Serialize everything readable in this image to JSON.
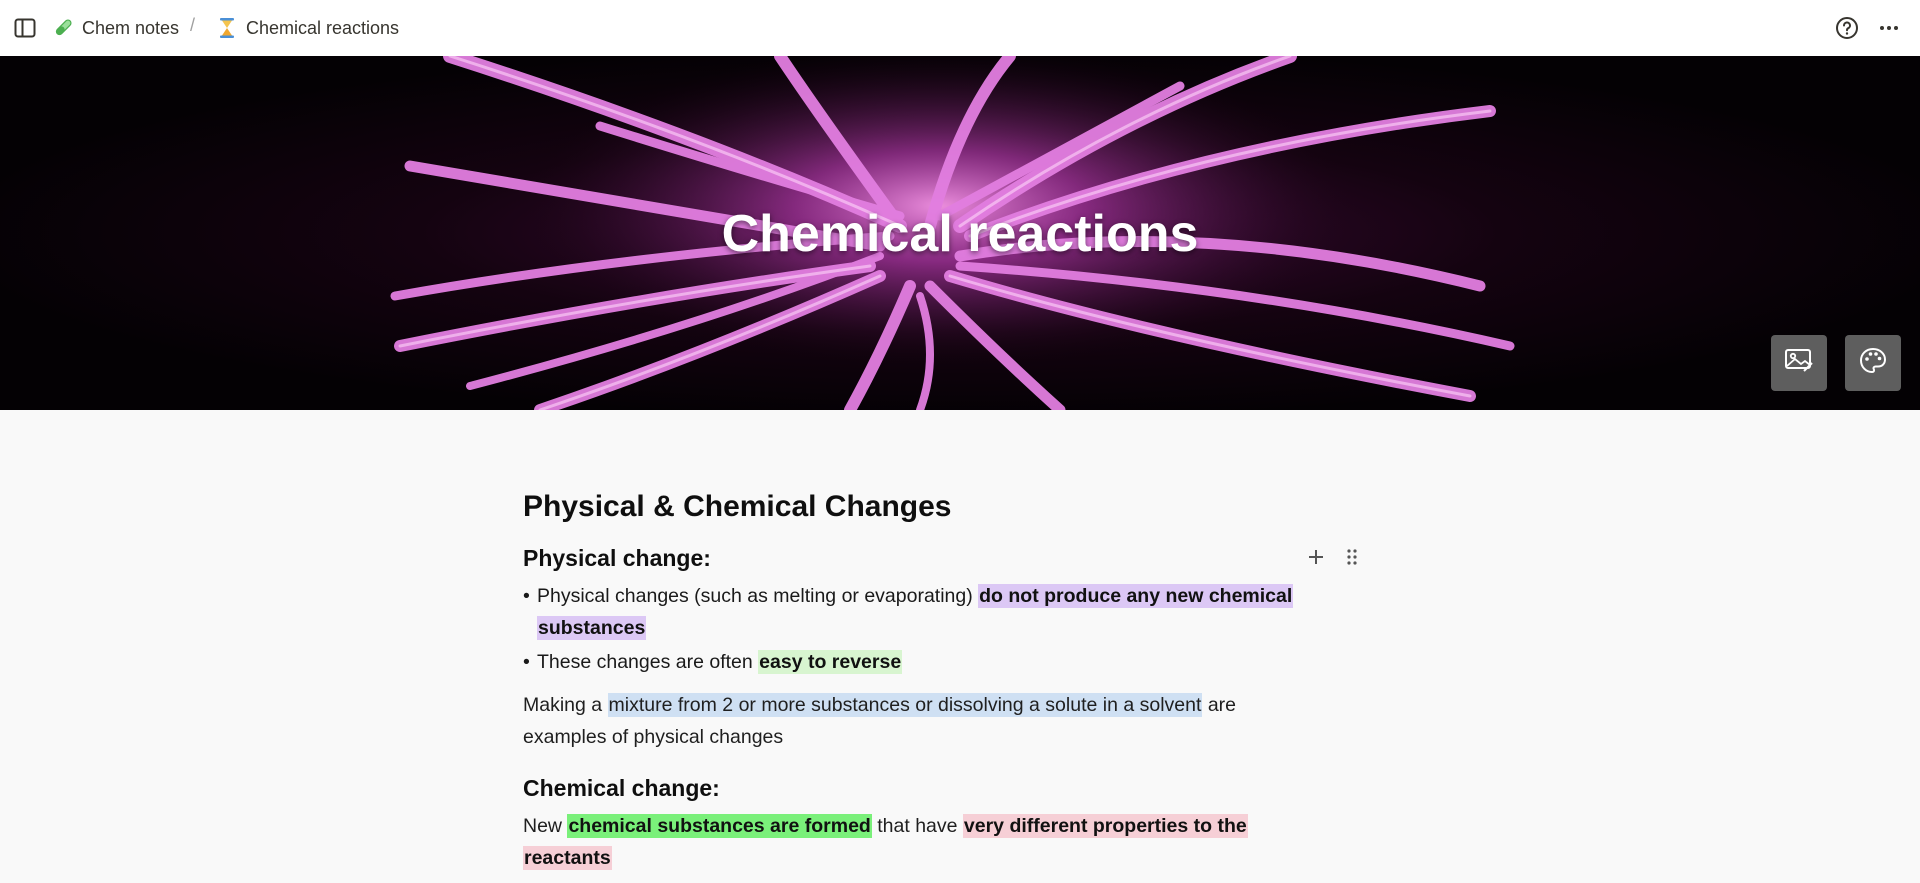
{
  "breadcrumb": {
    "items": [
      {
        "label": "Chem notes",
        "icon": "test-tube-icon"
      },
      {
        "label": "Chemical reactions",
        "icon": "hourglass-icon"
      }
    ],
    "separator": "/"
  },
  "cover": {
    "title": "Chemical reactions",
    "image": "pink-firework-burst",
    "colors": {
      "burst": "#e070e0",
      "background": "#060106"
    }
  },
  "page": {
    "heading": "Physical & Chemical Changes",
    "sections": {
      "physical": {
        "heading": "Physical change:",
        "bullet1_plain": "Physical changes (such as melting or evaporating) ",
        "bullet1_highlight_a": "do not produce any new chemical",
        "bullet1_highlight_b": "substances",
        "bullet2_plain": "These changes are often ",
        "bullet2_highlight": "easy to reverse",
        "para_start": "Making a ",
        "para_highlight": "mixture from 2 or more substances or dissolving a solute in a solvent",
        "para_end_a": " are",
        "para_end_b": "examples of physical changes"
      },
      "chemical": {
        "heading": "Chemical change:",
        "para_start": "New ",
        "para_highlight_a": "chemical substances are formed",
        "para_mid": " that have ",
        "para_highlight_b": "very different properties to the",
        "para_highlight_c": "reactants"
      }
    },
    "bullet_glyph": "•"
  },
  "highlight_colors": {
    "purple": "#dcc8f5",
    "light_green": "#d8f5d0",
    "blue": "#cfe0f3",
    "bright_green": "#7af07a",
    "pink": "#f6cfd6"
  }
}
